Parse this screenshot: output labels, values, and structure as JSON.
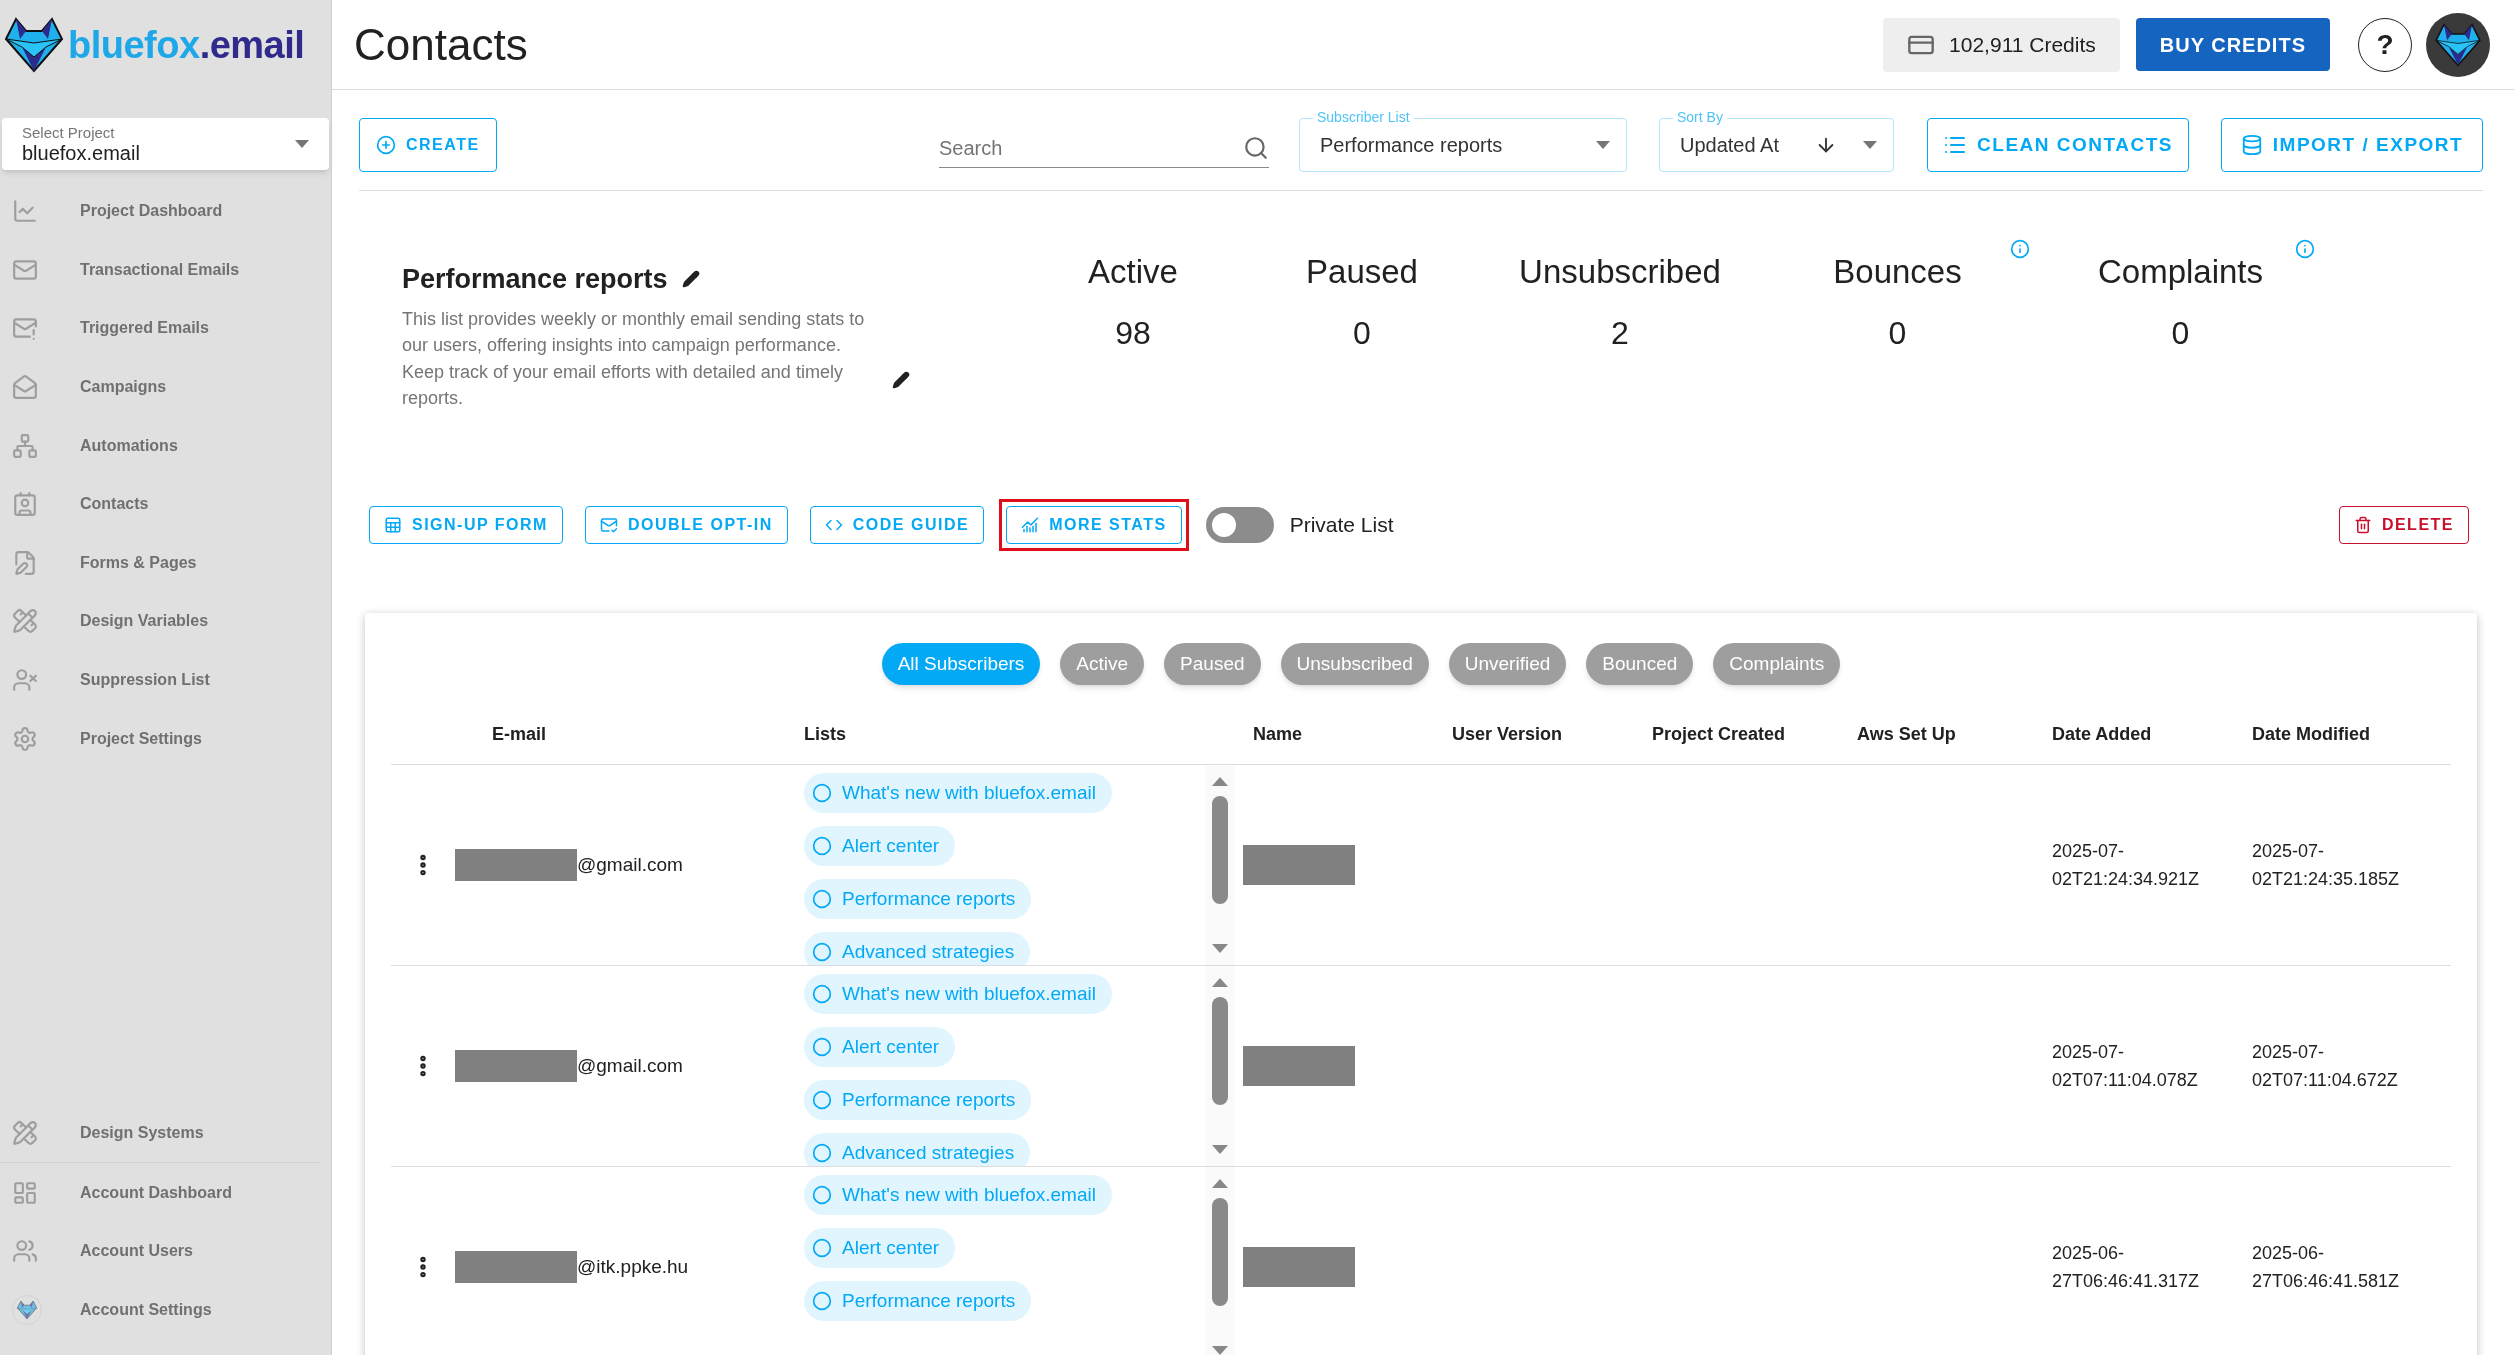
{
  "logo": {
    "name": "bluefox",
    "suffix": ".email"
  },
  "project_select": {
    "label": "Select Project",
    "value": "bluefox.email"
  },
  "sidebar": {
    "items": [
      {
        "label": "Project Dashboard"
      },
      {
        "label": "Transactional Emails"
      },
      {
        "label": "Triggered Emails"
      },
      {
        "label": "Campaigns"
      },
      {
        "label": "Automations"
      },
      {
        "label": "Contacts"
      },
      {
        "label": "Forms & Pages"
      },
      {
        "label": "Design Variables"
      },
      {
        "label": "Suppression List"
      },
      {
        "label": "Project Settings"
      }
    ],
    "bottom_items": [
      {
        "label": "Design Systems"
      },
      {
        "label": "Account Dashboard"
      },
      {
        "label": "Account Users"
      },
      {
        "label": "Account Settings"
      }
    ]
  },
  "page_title": "Contacts",
  "credits": "102,911 Credits",
  "buy_button": "BUY CREDITS",
  "help_button": "?",
  "toolbar": {
    "create": "CREATE",
    "search": {
      "placeholder": "Search"
    },
    "subscriber_list": {
      "label": "Subscriber List",
      "value": "Performance reports"
    },
    "sort_by": {
      "label": "Sort By",
      "value": "Updated At"
    },
    "clean": "CLEAN CONTACTS",
    "import_export": "IMPORT / EXPORT"
  },
  "list_info": {
    "title": "Performance reports",
    "description": "This list provides weekly or monthly email sending stats to our users, offering insights into campaign performance. Keep track of your email efforts with detailed and timely reports."
  },
  "stats": [
    {
      "label": "Active",
      "value": "98",
      "info": false
    },
    {
      "label": "Paused",
      "value": "0",
      "info": false
    },
    {
      "label": "Unsubscribed",
      "value": "2",
      "info": false
    },
    {
      "label": "Bounces",
      "value": "0",
      "info": true
    },
    {
      "label": "Complaints",
      "value": "0",
      "info": true
    }
  ],
  "actions": [
    {
      "label": "SIGN-UP FORM",
      "highlighted": false
    },
    {
      "label": "DOUBLE OPT-IN",
      "highlighted": false
    },
    {
      "label": "CODE GUIDE",
      "highlighted": false
    },
    {
      "label": "MORE STATS",
      "highlighted": true
    }
  ],
  "private_list": {
    "label": "Private List",
    "on": false
  },
  "delete_button": "DELETE",
  "filters": [
    {
      "label": "All Subscribers",
      "selected": true
    },
    {
      "label": "Active",
      "selected": false
    },
    {
      "label": "Paused",
      "selected": false
    },
    {
      "label": "Unsubscribed",
      "selected": false
    },
    {
      "label": "Unverified",
      "selected": false
    },
    {
      "label": "Bounced",
      "selected": false
    },
    {
      "label": "Complaints",
      "selected": false
    }
  ],
  "table": {
    "columns": [
      "E-mail",
      "Lists",
      "Name",
      "User Version",
      "Project Created",
      "Aws Set Up",
      "Date Added",
      "Date Modified"
    ],
    "rows": [
      {
        "email": "@gmail.com",
        "email_redacted": true,
        "name_redacted": true,
        "lists": [
          "What's new with bluefox.email",
          "Alert center",
          "Performance reports",
          "Advanced strategies"
        ],
        "date_added": "2025-07-02T21:24:34.921Z",
        "date_modified": "2025-07-02T21:24:35.185Z"
      },
      {
        "email": "@gmail.com",
        "email_redacted": true,
        "name_redacted": true,
        "lists": [
          "What's new with bluefox.email",
          "Alert center",
          "Performance reports",
          "Advanced strategies"
        ],
        "date_added": "2025-07-02T07:11:04.078Z",
        "date_modified": "2025-07-02T07:11:04.672Z"
      },
      {
        "email": "@itk.ppke.hu",
        "email_redacted": true,
        "name_redacted": true,
        "lists": [
          "What's new with bluefox.email",
          "Alert center",
          "Performance reports"
        ],
        "date_added": "2025-06-27T06:46:41.317Z",
        "date_modified": "2025-06-27T06:46:41.581Z"
      }
    ]
  }
}
